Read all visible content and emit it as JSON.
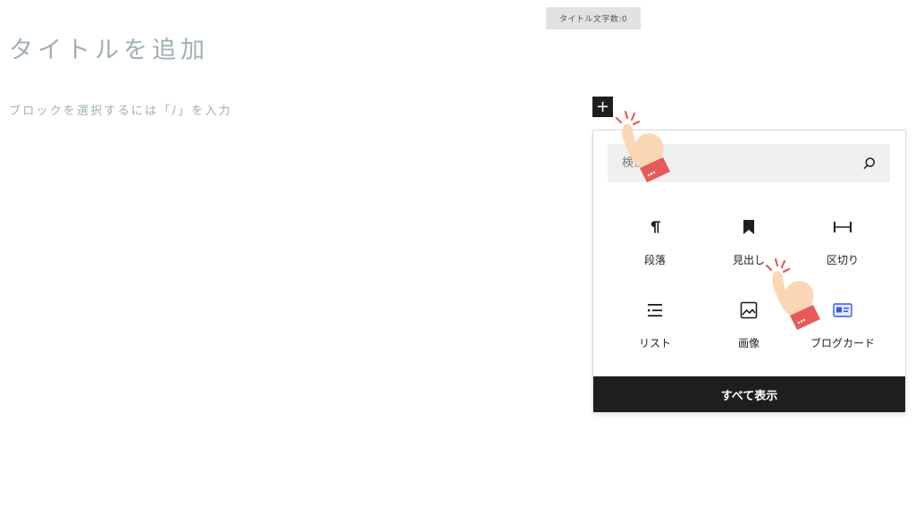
{
  "counter": {
    "label": "タイトル文字数:0"
  },
  "editor": {
    "title_placeholder": "タイトルを追加",
    "block_hint": "ブロックを選択するには「/」を入力"
  },
  "inserter": {
    "add_button_label": "+",
    "search": {
      "placeholder": "検索"
    },
    "blocks": [
      {
        "label": "段落",
        "icon": "paragraph-icon"
      },
      {
        "label": "見出し",
        "icon": "heading-icon"
      },
      {
        "label": "区切り",
        "icon": "separator-icon"
      },
      {
        "label": "リスト",
        "icon": "list-icon"
      },
      {
        "label": "画像",
        "icon": "image-icon"
      },
      {
        "label": "ブログカード",
        "icon": "blog-card-icon"
      }
    ],
    "show_all_label": "すべて表示"
  },
  "colors": {
    "dark": "#1e1e1e",
    "placeholder_text": "#9fb0b5",
    "hand_cuff": "#e85a5a",
    "accent_blue": "#3858e9"
  }
}
